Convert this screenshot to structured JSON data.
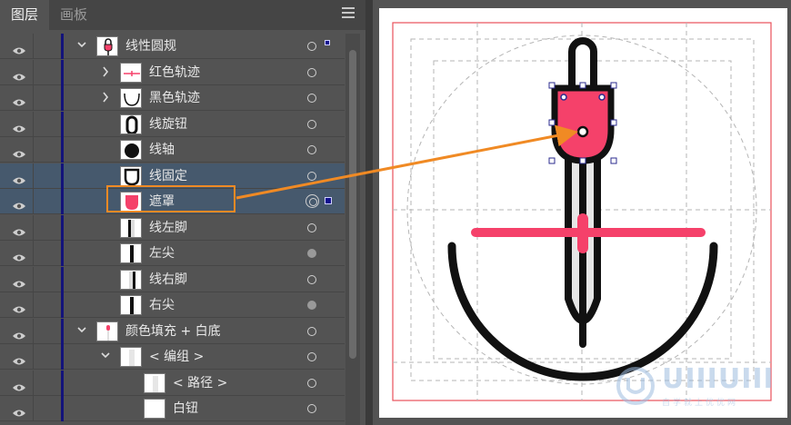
{
  "panel": {
    "tabs": [
      {
        "label": "图层",
        "active": true
      },
      {
        "label": "画板",
        "active": false
      }
    ],
    "layers": [
      {
        "name": "线性圆规",
        "indent": 0,
        "chevron": "down",
        "thumb": "compass",
        "target": "hollow",
        "selected": false
      },
      {
        "name": "红色轨迹",
        "indent": 1,
        "chevron": "right",
        "thumb": "red-line",
        "target": "hollow",
        "selected": false
      },
      {
        "name": "黑色轨迹",
        "indent": 1,
        "chevron": "right",
        "thumb": "black-arc",
        "target": "hollow",
        "selected": false
      },
      {
        "name": "线旋钮",
        "indent": 1,
        "chevron": "",
        "thumb": "knob",
        "target": "hollow",
        "selected": false
      },
      {
        "name": "线轴",
        "indent": 1,
        "chevron": "",
        "thumb": "axis",
        "target": "hollow",
        "selected": false
      },
      {
        "name": "线固定",
        "indent": 1,
        "chevron": "",
        "thumb": "fixed",
        "target": "hollow",
        "selected": true
      },
      {
        "name": "遮罩",
        "indent": 1,
        "chevron": "",
        "thumb": "mask",
        "target": "double",
        "selected": true
      },
      {
        "name": "线左脚",
        "indent": 1,
        "chevron": "",
        "thumb": "left-leg",
        "target": "hollow",
        "selected": false
      },
      {
        "name": "左尖",
        "indent": 1,
        "chevron": "",
        "thumb": "left-tip",
        "target": "filled",
        "selected": false
      },
      {
        "name": "线右脚",
        "indent": 1,
        "chevron": "",
        "thumb": "right-leg",
        "target": "hollow",
        "selected": false
      },
      {
        "name": "右尖",
        "indent": 1,
        "chevron": "",
        "thumb": "right-tip",
        "target": "filled",
        "selected": false
      },
      {
        "name": "颜色填充 + 白底",
        "indent": 0,
        "chevron": "down",
        "thumb": "fill",
        "target": "hollow",
        "selected": false
      },
      {
        "name": "< 编组 >",
        "indent": 1,
        "chevron": "down",
        "thumb": "group",
        "target": "hollow",
        "selected": false
      },
      {
        "name": "< 路径 >",
        "indent": 2,
        "chevron": "",
        "thumb": "path",
        "target": "hollow",
        "selected": false
      },
      {
        "name": "白钮",
        "indent": 2,
        "chevron": "",
        "thumb": "white",
        "target": "hollow",
        "selected": false
      }
    ]
  },
  "watermark": {
    "text": "UIIIUIII",
    "subtext": "自学就上优优网"
  },
  "colors": {
    "accent": "#f5416a",
    "selection": "#46596d",
    "callout": "#f08a24",
    "layer_bar": "#13137a",
    "artboard_border": "#e8505b",
    "stroke": "#111111"
  },
  "icons": {
    "visibility": "eye-icon",
    "menu": "hamburger-menu-icon"
  }
}
